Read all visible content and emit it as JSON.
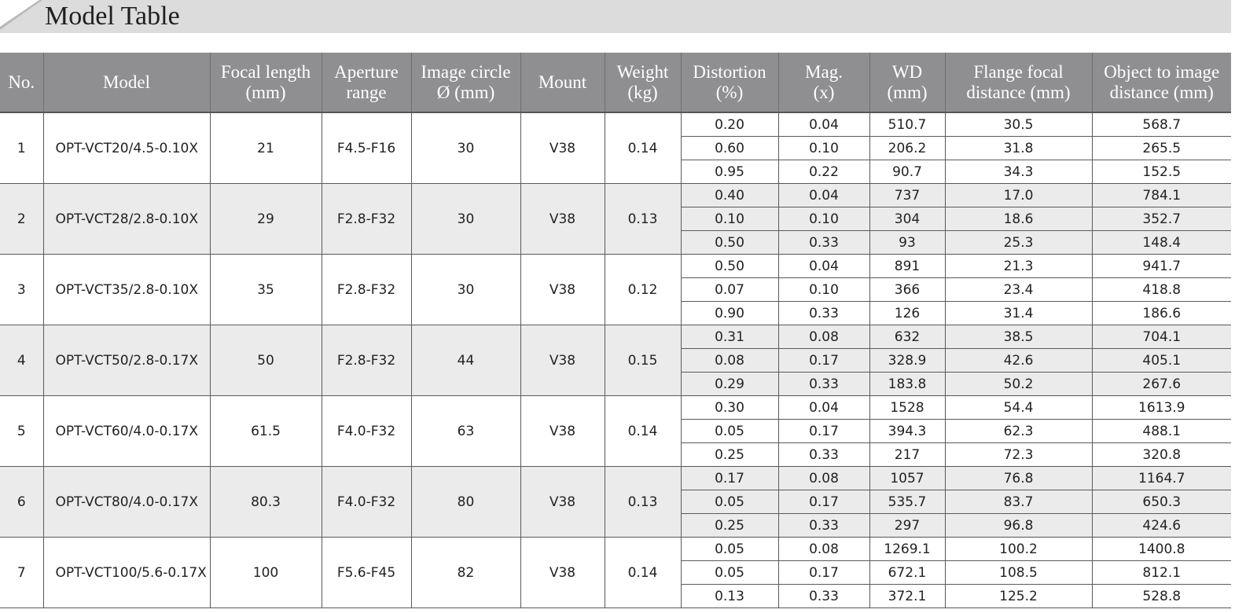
{
  "title": "Model Table",
  "headers": {
    "no": "No.",
    "model": "Model",
    "focal": [
      "Focal length",
      "(mm)"
    ],
    "aperture": [
      "Aperture",
      "range"
    ],
    "circle": [
      "Image circle",
      "Ø (mm)"
    ],
    "mount": "Mount",
    "weight": [
      "Weight",
      "(kg)"
    ],
    "distortion": [
      "Distortion",
      "(%)"
    ],
    "mag": [
      "Mag.",
      "(x)"
    ],
    "wd": [
      "WD",
      "(mm)"
    ],
    "flange": [
      "Flange focal",
      "distance (mm)"
    ],
    "oti": [
      "Object to image",
      "distance (mm)"
    ]
  },
  "rows": [
    {
      "no": "1",
      "model": "OPT-VCT20/4.5-0.10X",
      "focal": "21",
      "aperture": "F4.5-F16",
      "circle": "30",
      "mount": "V38",
      "weight": "0.14",
      "sub": [
        [
          "0.20",
          "0.04",
          "510.7",
          "30.5",
          "568.7"
        ],
        [
          "0.60",
          "0.10",
          "206.2",
          "31.8",
          "265.5"
        ],
        [
          "0.95",
          "0.22",
          "90.7",
          "34.3",
          "152.5"
        ]
      ]
    },
    {
      "no": "2",
      "model": "OPT-VCT28/2.8-0.10X",
      "focal": "29",
      "aperture": "F2.8-F32",
      "circle": "30",
      "mount": "V38",
      "weight": "0.13",
      "sub": [
        [
          "0.40",
          "0.04",
          "737",
          "17.0",
          "784.1"
        ],
        [
          "0.10",
          "0.10",
          "304",
          "18.6",
          "352.7"
        ],
        [
          "0.50",
          "0.33",
          "93",
          "25.3",
          "148.4"
        ]
      ]
    },
    {
      "no": "3",
      "model": "OPT-VCT35/2.8-0.10X",
      "focal": "35",
      "aperture": "F2.8-F32",
      "circle": "30",
      "mount": "V38",
      "weight": "0.12",
      "sub": [
        [
          "0.50",
          "0.04",
          "891",
          "21.3",
          "941.7"
        ],
        [
          "0.07",
          "0.10",
          "366",
          "23.4",
          "418.8"
        ],
        [
          "0.90",
          "0.33",
          "126",
          "31.4",
          "186.6"
        ]
      ]
    },
    {
      "no": "4",
      "model": "OPT-VCT50/2.8-0.17X",
      "focal": "50",
      "aperture": "F2.8-F32",
      "circle": "44",
      "mount": "V38",
      "weight": "0.15",
      "sub": [
        [
          "0.31",
          "0.08",
          "632",
          "38.5",
          "704.1"
        ],
        [
          "0.08",
          "0.17",
          "328.9",
          "42.6",
          "405.1"
        ],
        [
          "0.29",
          "0.33",
          "183.8",
          "50.2",
          "267.6"
        ]
      ]
    },
    {
      "no": "5",
      "model": "OPT-VCT60/4.0-0.17X",
      "focal": "61.5",
      "aperture": "F4.0-F32",
      "circle": "63",
      "mount": "V38",
      "weight": "0.14",
      "sub": [
        [
          "0.30",
          "0.04",
          "1528",
          "54.4",
          "1613.9"
        ],
        [
          "0.05",
          "0.17",
          "394.3",
          "62.3",
          "488.1"
        ],
        [
          "0.25",
          "0.33",
          "217",
          "72.3",
          "320.8"
        ]
      ]
    },
    {
      "no": "6",
      "model": "OPT-VCT80/4.0-0.17X",
      "focal": "80.3",
      "aperture": "F4.0-F32",
      "circle": "80",
      "mount": "V38",
      "weight": "0.13",
      "sub": [
        [
          "0.17",
          "0.08",
          "1057",
          "76.8",
          "1164.7"
        ],
        [
          "0.05",
          "0.17",
          "535.7",
          "83.7",
          "650.3"
        ],
        [
          "0.25",
          "0.33",
          "297",
          "96.8",
          "424.6"
        ]
      ]
    },
    {
      "no": "7",
      "model": "OPT-VCT100/5.6-0.17X",
      "focal": "100",
      "aperture": "F5.6-F45",
      "circle": "82",
      "mount": "V38",
      "weight": "0.14",
      "sub": [
        [
          "0.05",
          "0.08",
          "1269.1",
          "100.2",
          "1400.8"
        ],
        [
          "0.05",
          "0.17",
          "672.1",
          "108.5",
          "812.1"
        ],
        [
          "0.13",
          "0.33",
          "372.1",
          "125.2",
          "528.8"
        ]
      ]
    }
  ]
}
